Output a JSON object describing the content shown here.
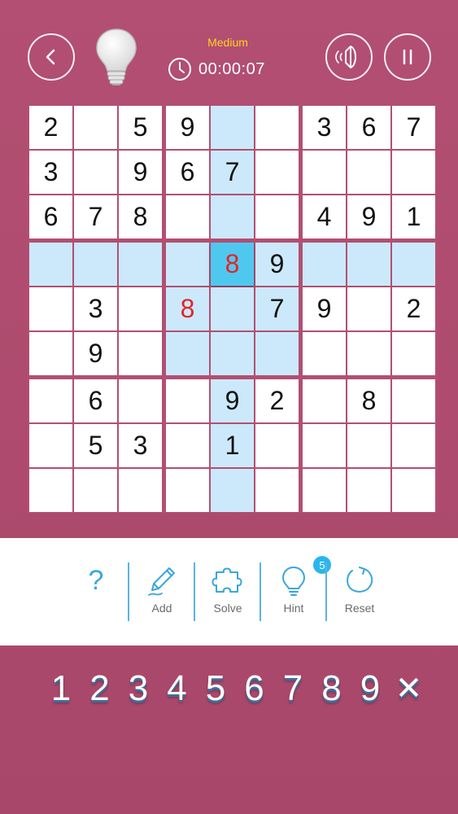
{
  "header": {
    "difficulty": "Medium",
    "timer": "00:00:07",
    "icons": {
      "back": "chevron-left-icon",
      "lightbulb": "lightbulb-icon",
      "clock": "clock-icon",
      "sound": "speaker-icon",
      "pause": "pause-icon"
    }
  },
  "board": {
    "grid": [
      [
        "2",
        "",
        "5",
        "9",
        "",
        "",
        "3",
        "6",
        "7"
      ],
      [
        "3",
        "",
        "9",
        "6",
        "7",
        "",
        "",
        "",
        ""
      ],
      [
        "6",
        "7",
        "8",
        "",
        "",
        "",
        "4",
        "9",
        "1"
      ],
      [
        "",
        "",
        "",
        "",
        "8",
        "9",
        "",
        "",
        ""
      ],
      [
        "",
        "3",
        "",
        "8",
        "",
        "7",
        "9",
        "",
        "2"
      ],
      [
        "",
        "9",
        "",
        "",
        "",
        "",
        "",
        "",
        ""
      ],
      [
        "",
        "6",
        "",
        "",
        "9",
        "2",
        "",
        "8",
        ""
      ],
      [
        "",
        "5",
        "3",
        "",
        "1",
        "",
        "",
        "",
        ""
      ],
      [
        "",
        "",
        "",
        "",
        "",
        "",
        "",
        "",
        ""
      ]
    ],
    "selected": {
      "row": 3,
      "col": 4
    },
    "error_cells": [
      [
        3,
        4
      ],
      [
        4,
        3
      ]
    ],
    "colors": {
      "highlight": "#cbe9fb",
      "selected": "#4fc8f0",
      "error_text": "#e52424",
      "divider": "#b24f72"
    }
  },
  "toolbar": {
    "help_label": "?",
    "add_label": "Add",
    "solve_label": "Solve",
    "hint_label": "Hint",
    "hint_count": "5",
    "reset_label": "Reset",
    "icons": {
      "add": "pencil-icon",
      "solve": "puzzle-icon",
      "hint": "lightbulb-icon",
      "reset": "refresh-icon"
    }
  },
  "numpad": {
    "keys": [
      "1",
      "2",
      "3",
      "4",
      "5",
      "6",
      "7",
      "8",
      "9"
    ],
    "clear": "✕"
  }
}
